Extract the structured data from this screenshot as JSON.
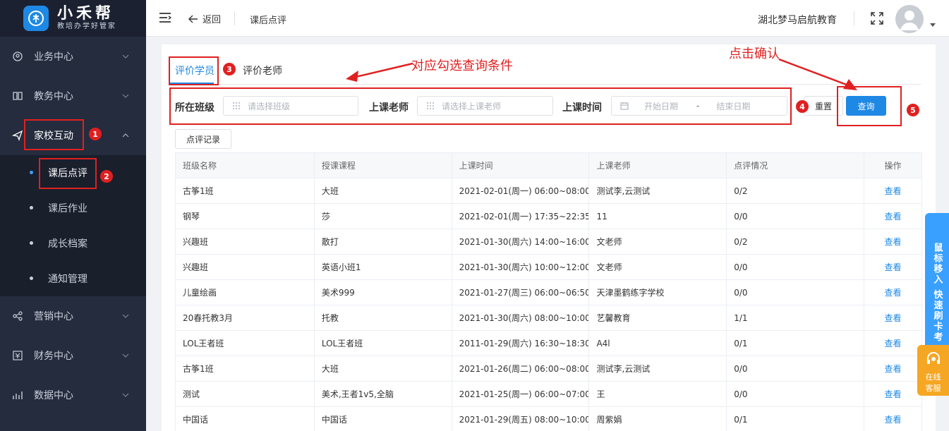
{
  "app": {
    "logo_title": "小禾帮",
    "logo_subtitle": "教培办学好管家"
  },
  "sidebar": {
    "items": [
      {
        "label": "业务中心",
        "icon": "business-icon"
      },
      {
        "label": "教务中心",
        "icon": "book-icon"
      },
      {
        "label": "家校互动",
        "icon": "send-icon"
      },
      {
        "label": "营销中心",
        "icon": "share-icon"
      },
      {
        "label": "财务中心",
        "icon": "finance-icon"
      },
      {
        "label": "数据中心",
        "icon": "chart-icon"
      }
    ],
    "sub_items": [
      {
        "label": "课后点评",
        "active": true
      },
      {
        "label": "课后作业"
      },
      {
        "label": "成长档案"
      },
      {
        "label": "通知管理"
      }
    ]
  },
  "header": {
    "back_label": "返回",
    "breadcrumb": "课后点评",
    "org_name": "湖北梦马启航教育"
  },
  "tabs": [
    {
      "label": "评价学员",
      "active": true
    },
    {
      "label": "评价老师"
    }
  ],
  "filters": {
    "class_label": "所在班级",
    "class_placeholder": "请选择班级",
    "teacher_label": "上课老师",
    "teacher_placeholder": "请选择上课老师",
    "time_label": "上课时间",
    "start_placeholder": "开始日期",
    "range_sep": "-",
    "end_placeholder": "结束日期",
    "reset_label": "重置",
    "query_label": "查询"
  },
  "record_button": "点评记录",
  "table": {
    "headers": [
      "班级名称",
      "授课课程",
      "上课时间",
      "上课老师",
      "点评情况",
      "操作"
    ],
    "rows": [
      [
        "古筝1班",
        "大班",
        "2021-02-01(周一) 06:00~08:00",
        "测试李,云测试",
        "0/2",
        "查看"
      ],
      [
        "钢琴",
        "莎",
        "2021-02-01(周一) 17:35~22:35",
        "11",
        "0/0",
        "查看"
      ],
      [
        "兴趣班",
        "散打",
        "2021-01-30(周六) 14:00~16:00",
        "文老师",
        "0/2",
        "查看"
      ],
      [
        "兴趣班",
        "英语小班1",
        "2021-01-30(周六) 10:00~12:00",
        "文老师",
        "0/0",
        "查看"
      ],
      [
        "儿童绘画",
        "美术999",
        "2021-01-27(周三) 06:00~06:50",
        "天津墨鹤练字学校",
        "0/0",
        "查看"
      ],
      [
        "20春托教3月",
        "托教",
        "2021-01-30(周六) 08:00~10:00",
        "艺馨教育",
        "1/1",
        "查看"
      ],
      [
        "LOL王者班",
        "LOL王者班",
        "2011-01-29(周六) 16:30~18:30",
        "A4l",
        "0/1",
        "查看"
      ],
      [
        "古筝1班",
        "大班",
        "2021-01-26(周二) 06:00~08:00",
        "测试李,云测试",
        "0/0",
        "查看"
      ],
      [
        "测试",
        "美术,王者1v5,全脑",
        "2021-01-25(周一) 06:00~07:00",
        "王",
        "0/0",
        "查看"
      ],
      [
        "中国话",
        "中国话",
        "2021-01-29(周五) 08:00~10:00",
        "周紫娟",
        "0/1",
        "查看"
      ]
    ]
  },
  "annotations": {
    "condition_note": "对应勾选查询条件",
    "confirm_note": "点击确认",
    "markers": [
      "1",
      "2",
      "3",
      "4",
      "5"
    ]
  },
  "floating": {
    "quick_text": "鼠标移入 快速刷卡考",
    "service_text_1": "在线",
    "service_text_2": "客服"
  },
  "colors": {
    "primary": "#1e88e5",
    "sidebar_bg": "#252c3d",
    "annotation": "#e02020",
    "service": "#f5a623"
  }
}
